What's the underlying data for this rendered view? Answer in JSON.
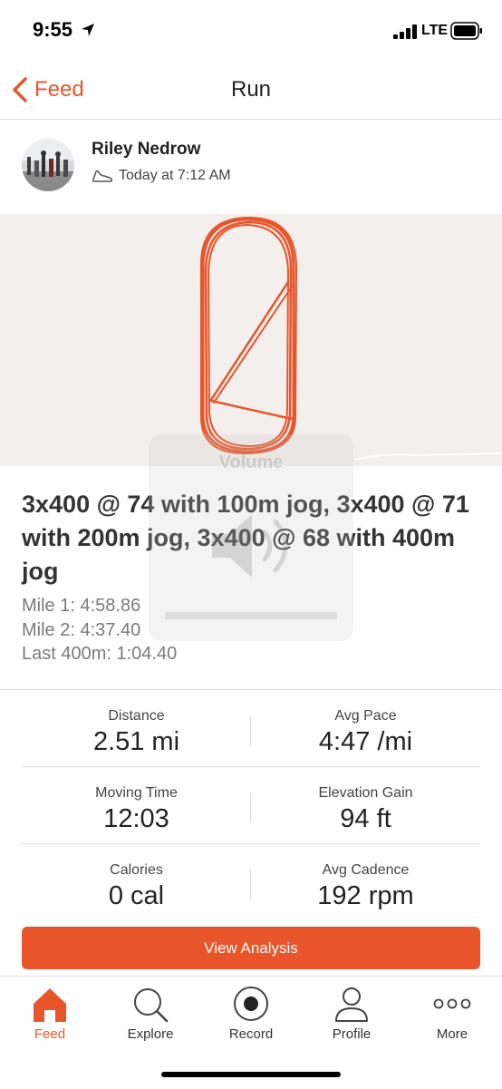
{
  "status_bar": {
    "time": "9:55",
    "network": "LTE",
    "icons": [
      "location-arrow-icon",
      "signal-icon",
      "battery-icon"
    ]
  },
  "nav": {
    "back_label": "Feed",
    "title": "Run"
  },
  "athlete": {
    "name": "Riley Nedrow",
    "time": "Today at 7:12 AM",
    "activity_icon": "shoe-icon"
  },
  "activity": {
    "title": "3x400 @ 74 with 100m jog, 3x400 @ 71 with 200m jog, 3x400 @ 68 with 400m  jog",
    "description": [
      "Mile 1: 4:58.86",
      "Mile 2: 4:37.40",
      "Last 400m: 1:04.40"
    ]
  },
  "volume_overlay": {
    "label": "Volume"
  },
  "stats": [
    [
      {
        "label": "Distance",
        "value": "2.51 mi"
      },
      {
        "label": "Avg Pace",
        "value": "4:47 /mi"
      }
    ],
    [
      {
        "label": "Moving Time",
        "value": "12:03"
      },
      {
        "label": "Elevation Gain",
        "value": "94 ft"
      }
    ],
    [
      {
        "label": "Calories",
        "value": "0 cal"
      },
      {
        "label": "Avg Cadence",
        "value": "192 rpm"
      }
    ]
  ],
  "analysis_button": {
    "label": "View Analysis"
  },
  "tabs": [
    {
      "label": "Feed",
      "icon": "home-icon",
      "active": true
    },
    {
      "label": "Explore",
      "icon": "search-icon",
      "active": false
    },
    {
      "label": "Record",
      "icon": "record-icon",
      "active": false
    },
    {
      "label": "Profile",
      "icon": "profile-icon",
      "active": false
    },
    {
      "label": "More",
      "icon": "more-icon",
      "active": false
    }
  ],
  "colors": {
    "accent": "#e8552a",
    "map_bg": "#f3efec",
    "divider": "#dddddd"
  }
}
